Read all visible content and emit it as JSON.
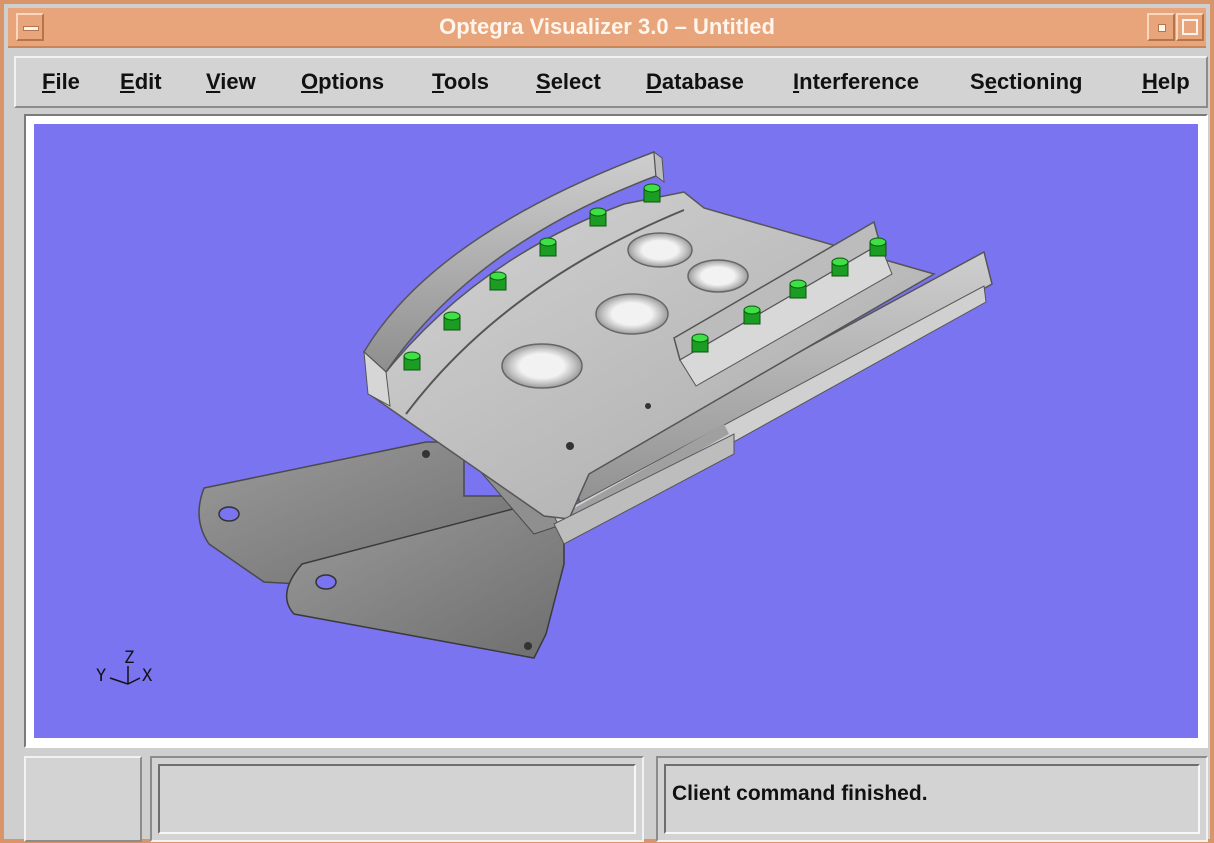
{
  "window": {
    "title": "Optegra Visualizer 3.0 – Untitled"
  },
  "menubar": {
    "items": [
      {
        "mnemonic": "F",
        "rest": "ile"
      },
      {
        "mnemonic": "E",
        "rest": "dit"
      },
      {
        "mnemonic": "V",
        "rest": "iew"
      },
      {
        "mnemonic": "O",
        "rest": "ptions"
      },
      {
        "mnemonic": "T",
        "rest": "ools"
      },
      {
        "mnemonic": "S",
        "rest": "elect"
      },
      {
        "mnemonic": "D",
        "rest": "atabase"
      },
      {
        "mnemonic": "I",
        "rest": "nterference"
      },
      {
        "pre": "S",
        "mnemonic": "e",
        "rest": "ctioning"
      },
      {
        "mnemonic": "H",
        "rest": "elp"
      }
    ]
  },
  "viewport": {
    "background_color": "#7a74f0",
    "model_color": "#b9b9b9",
    "fastener_color": "#22c02a",
    "triad": {
      "z": "Z",
      "y": "Y",
      "x": "X"
    }
  },
  "statusbar": {
    "message": "Client command finished."
  },
  "colors": {
    "titlebar": "#e8a47a",
    "chrome": "#d3d3d3"
  }
}
